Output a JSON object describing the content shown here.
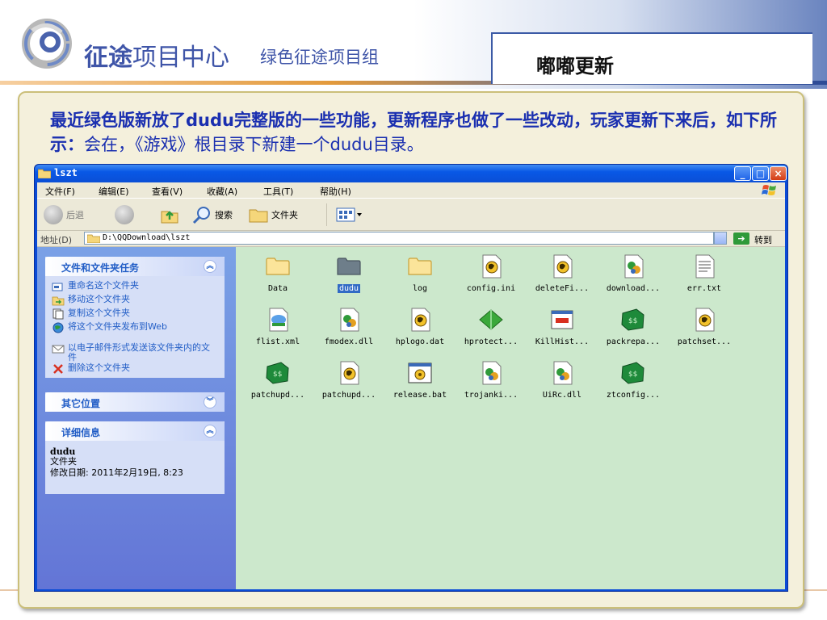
{
  "slide": {
    "brand_bold": "征途",
    "brand_rest": "项目中心",
    "brand_sub": "绿色征途项目组",
    "title": "嘟嘟更新",
    "intro_bold": "最近绿色版新放了dudu完整版的一些功能，更新程序也做了一些改动，玩家更新下来后，如下所示：",
    "intro_rest": "会在，《游戏》根目录下新建一个dudu目录。"
  },
  "window": {
    "title": "lszt",
    "menu": [
      "文件(F)",
      "编辑(E)",
      "查看(V)",
      "收藏(A)",
      "工具(T)",
      "帮助(H)"
    ],
    "toolbar": {
      "back": "后退",
      "search": "搜索",
      "folders": "文件夹"
    },
    "address": {
      "label": "地址(D)",
      "path": "D:\\QQDownload\\lszt",
      "go": "转到"
    },
    "controls": {
      "minimize": "_",
      "maximize": "□",
      "close": "×"
    }
  },
  "taskpane": {
    "file_tasks": {
      "title": "文件和文件夹任务",
      "items": [
        {
          "label": "重命名这个文件夹",
          "icon": "rename-icon"
        },
        {
          "label": "移动这个文件夹",
          "icon": "move-icon"
        },
        {
          "label": "复制这个文件夹",
          "icon": "copy-icon"
        },
        {
          "label": "将这个文件夹发布到Web",
          "icon": "web-publish-icon"
        },
        {
          "label": "以电子邮件形式发送该文件夹内的文件",
          "icon": "email-icon"
        },
        {
          "label": "删除这个文件夹",
          "icon": "delete-icon"
        }
      ]
    },
    "other_places": {
      "title": "其它位置"
    },
    "details": {
      "title": "详细信息",
      "name": "dudu",
      "type": "文件夹",
      "modified": "修改日期: 2011年2月19日, 8:23"
    }
  },
  "files": [
    {
      "name": "Data",
      "icon": "folder-icon"
    },
    {
      "name": "dudu",
      "icon": "folder-dark-icon",
      "selected": true
    },
    {
      "name": "log",
      "icon": "folder-icon"
    },
    {
      "name": "config.ini",
      "icon": "config-file-icon"
    },
    {
      "name": "deleteFi...",
      "icon": "config-file-icon"
    },
    {
      "name": "download...",
      "icon": "dll-icon"
    },
    {
      "name": "err.txt",
      "icon": "text-file-icon"
    },
    {
      "name": "flist.xml",
      "icon": "xml-file-icon"
    },
    {
      "name": "fmodex.dll",
      "icon": "dll-icon"
    },
    {
      "name": "hplogo.dat",
      "icon": "config-file-icon"
    },
    {
      "name": "hprotect...",
      "icon": "green-diamond-icon"
    },
    {
      "name": "KillHist...",
      "icon": "app-window-icon"
    },
    {
      "name": "packrepa...",
      "icon": "money-icon"
    },
    {
      "name": "patchset...",
      "icon": "config-file-icon"
    },
    {
      "name": "patchupd...",
      "icon": "money-icon"
    },
    {
      "name": "patchupd...",
      "icon": "config-file-icon"
    },
    {
      "name": "release.bat",
      "icon": "batch-file-icon"
    },
    {
      "name": "trojanki...",
      "icon": "dll-icon"
    },
    {
      "name": "UiRc.dll",
      "icon": "dll-icon"
    },
    {
      "name": "ztconfig...",
      "icon": "money-icon"
    }
  ],
  "colors": {
    "brand_blue": "#3f55a8",
    "xp_blue": "#0a4bd6",
    "file_area_bg": "#cce8cc",
    "intro_text": "#1a2fb0"
  }
}
